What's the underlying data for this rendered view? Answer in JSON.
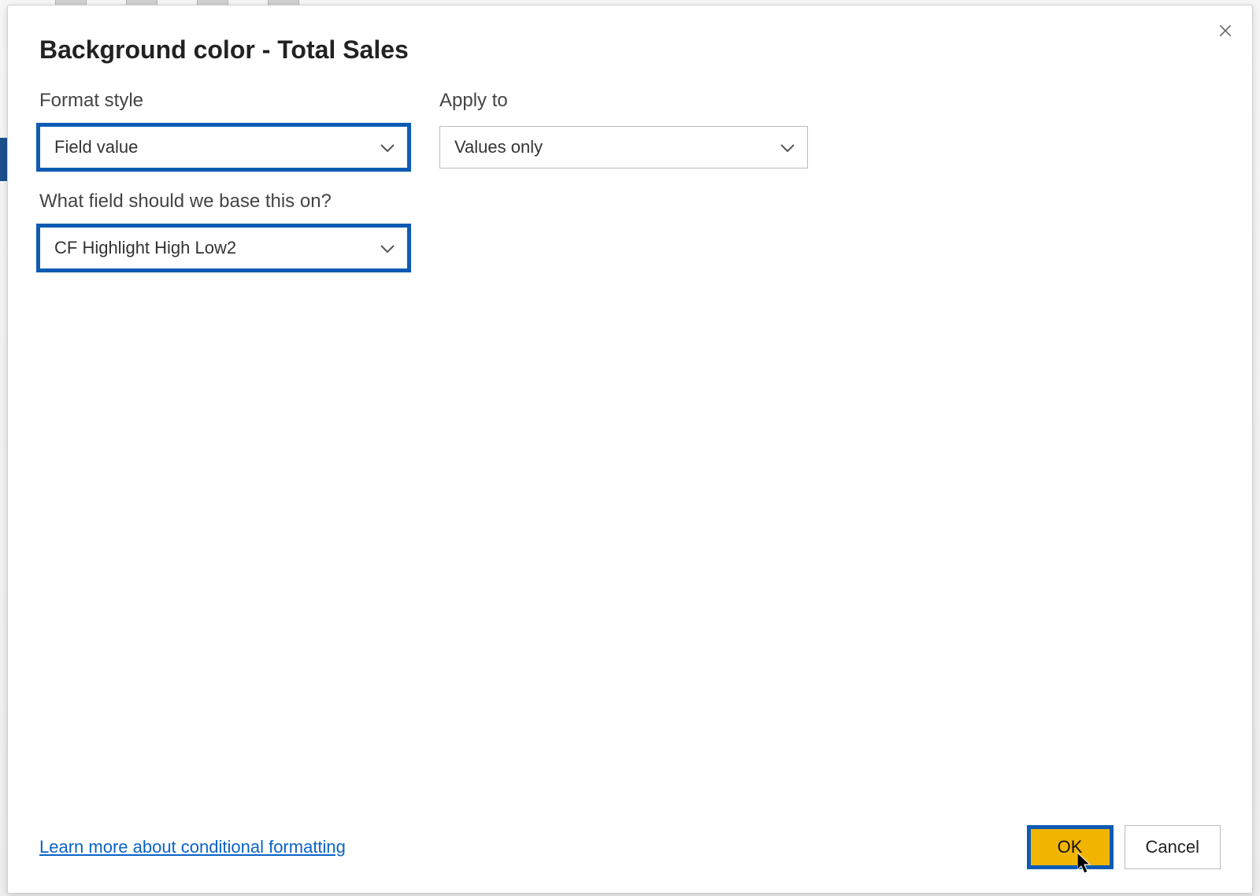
{
  "dialog": {
    "title": "Background color - Total Sales",
    "formatStyle": {
      "label": "Format style",
      "value": "Field value"
    },
    "applyTo": {
      "label": "Apply to",
      "value": "Values only"
    },
    "basedOn": {
      "label": "What field should we base this on?",
      "value": "CF Highlight High Low2"
    },
    "learnMoreLink": "Learn more about conditional formatting",
    "buttons": {
      "ok": "OK",
      "cancel": "Cancel"
    }
  }
}
